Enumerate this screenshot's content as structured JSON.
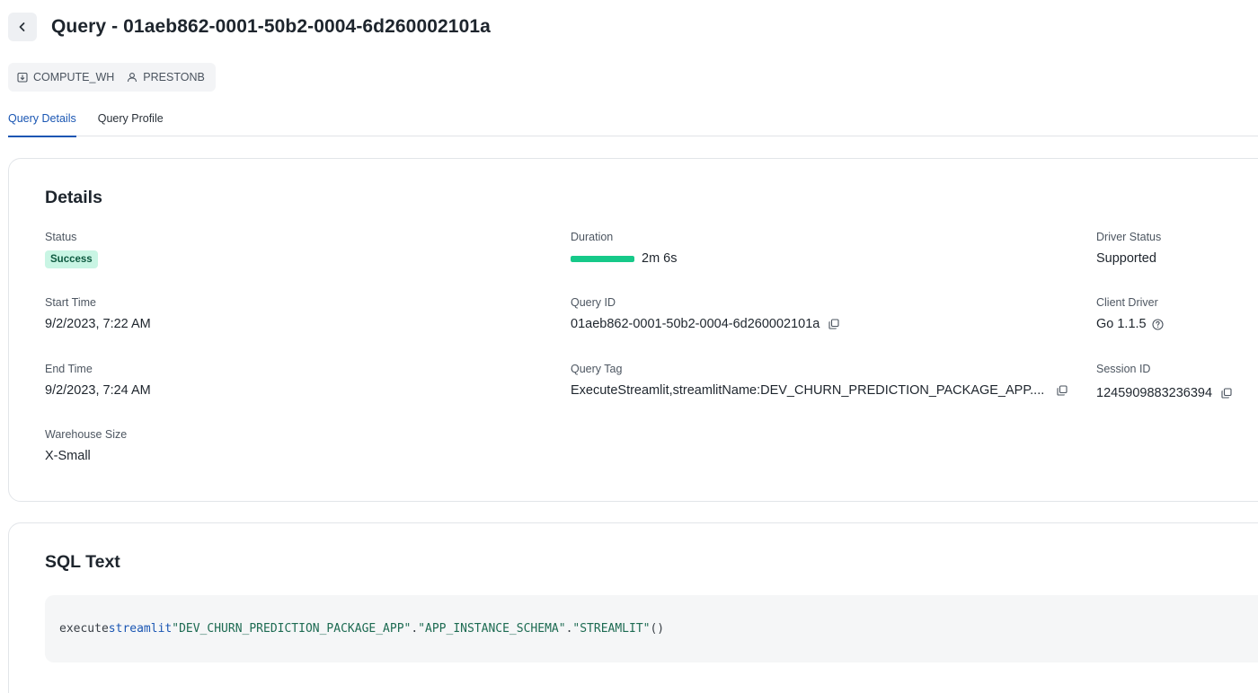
{
  "header": {
    "title": "Query - 01aeb862-0001-50b2-0004-6d260002101a"
  },
  "chips": {
    "warehouse": "COMPUTE_WH",
    "user": "PRESTONB"
  },
  "tabs": [
    {
      "label": "Query Details",
      "active": true
    },
    {
      "label": "Query Profile",
      "active": false
    }
  ],
  "details": {
    "title": "Details",
    "status": {
      "label": "Status",
      "value": "Success"
    },
    "start_time": {
      "label": "Start Time",
      "value": "9/2/2023, 7:22 AM"
    },
    "end_time": {
      "label": "End Time",
      "value": "9/2/2023, 7:24 AM"
    },
    "warehouse_size": {
      "label": "Warehouse Size",
      "value": "X-Small"
    },
    "duration": {
      "label": "Duration",
      "value": "2m 6s",
      "bar_fill": 1.0
    },
    "query_id": {
      "label": "Query ID",
      "value": "01aeb862-0001-50b2-0004-6d260002101a"
    },
    "query_tag": {
      "label": "Query Tag",
      "value": "ExecuteStreamlit,streamlitName:DEV_CHURN_PREDICTION_PACKAGE_APP...."
    },
    "driver_status": {
      "label": "Driver Status",
      "value": "Supported"
    },
    "client_driver": {
      "label": "Client Driver",
      "value": "Go 1.1.5"
    },
    "session_id": {
      "label": "Session ID",
      "value": "1245909883236394"
    }
  },
  "sql": {
    "title": "SQL Text",
    "tokens": {
      "t1": "execute",
      "t2": "streamlit",
      "t3": "\"DEV_CHURN_PREDICTION_PACKAGE_APP\"",
      "t4": ".",
      "t5": "\"APP_INSTANCE_SCHEMA\"",
      "t6": ".",
      "t7": "\"STREAMLIT\"",
      "t8": "()"
    }
  },
  "colors": {
    "accent": "#1a56b3",
    "success_bg": "#c9f5e4",
    "duration_bar": "#16c989"
  },
  "icons": {
    "back": "chevron-left-icon",
    "warehouse": "warehouse-icon",
    "user": "user-icon",
    "copy": "copy-icon",
    "help": "help-circle-icon"
  }
}
